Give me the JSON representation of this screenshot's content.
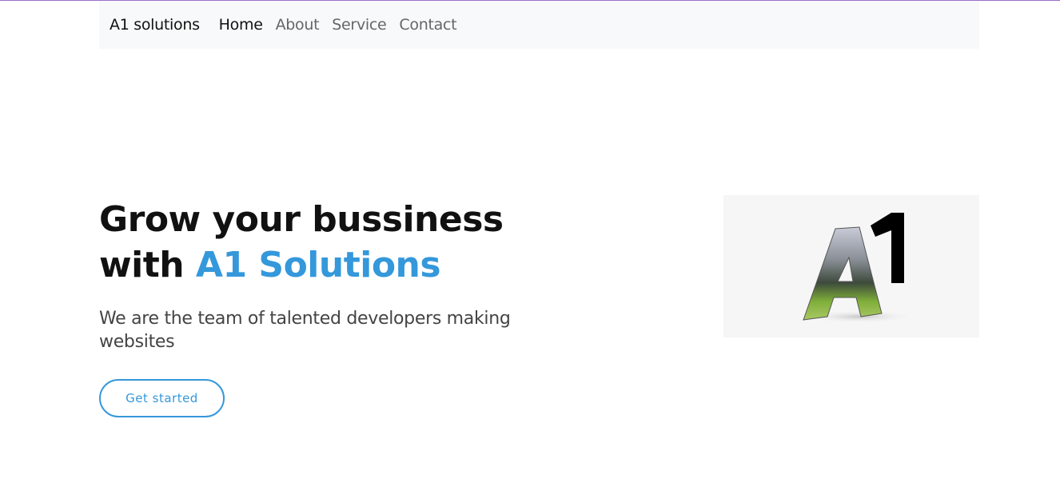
{
  "navbar": {
    "brand": "A1 solutions",
    "links": [
      {
        "label": "Home",
        "active": true
      },
      {
        "label": "About",
        "active": false
      },
      {
        "label": "Service",
        "active": false
      },
      {
        "label": "Contact",
        "active": false
      }
    ]
  },
  "hero": {
    "title_line1": "Grow your bussiness",
    "title_with": "with ",
    "title_accent": "A1 Solutions",
    "subtitle": "We are the team of talented developers making websites",
    "cta_label": "Get started",
    "logo_text": "A1"
  },
  "colors": {
    "accent": "#3498db",
    "navbar_bg": "#f8f9fa",
    "top_border": "#9b6fc7"
  }
}
